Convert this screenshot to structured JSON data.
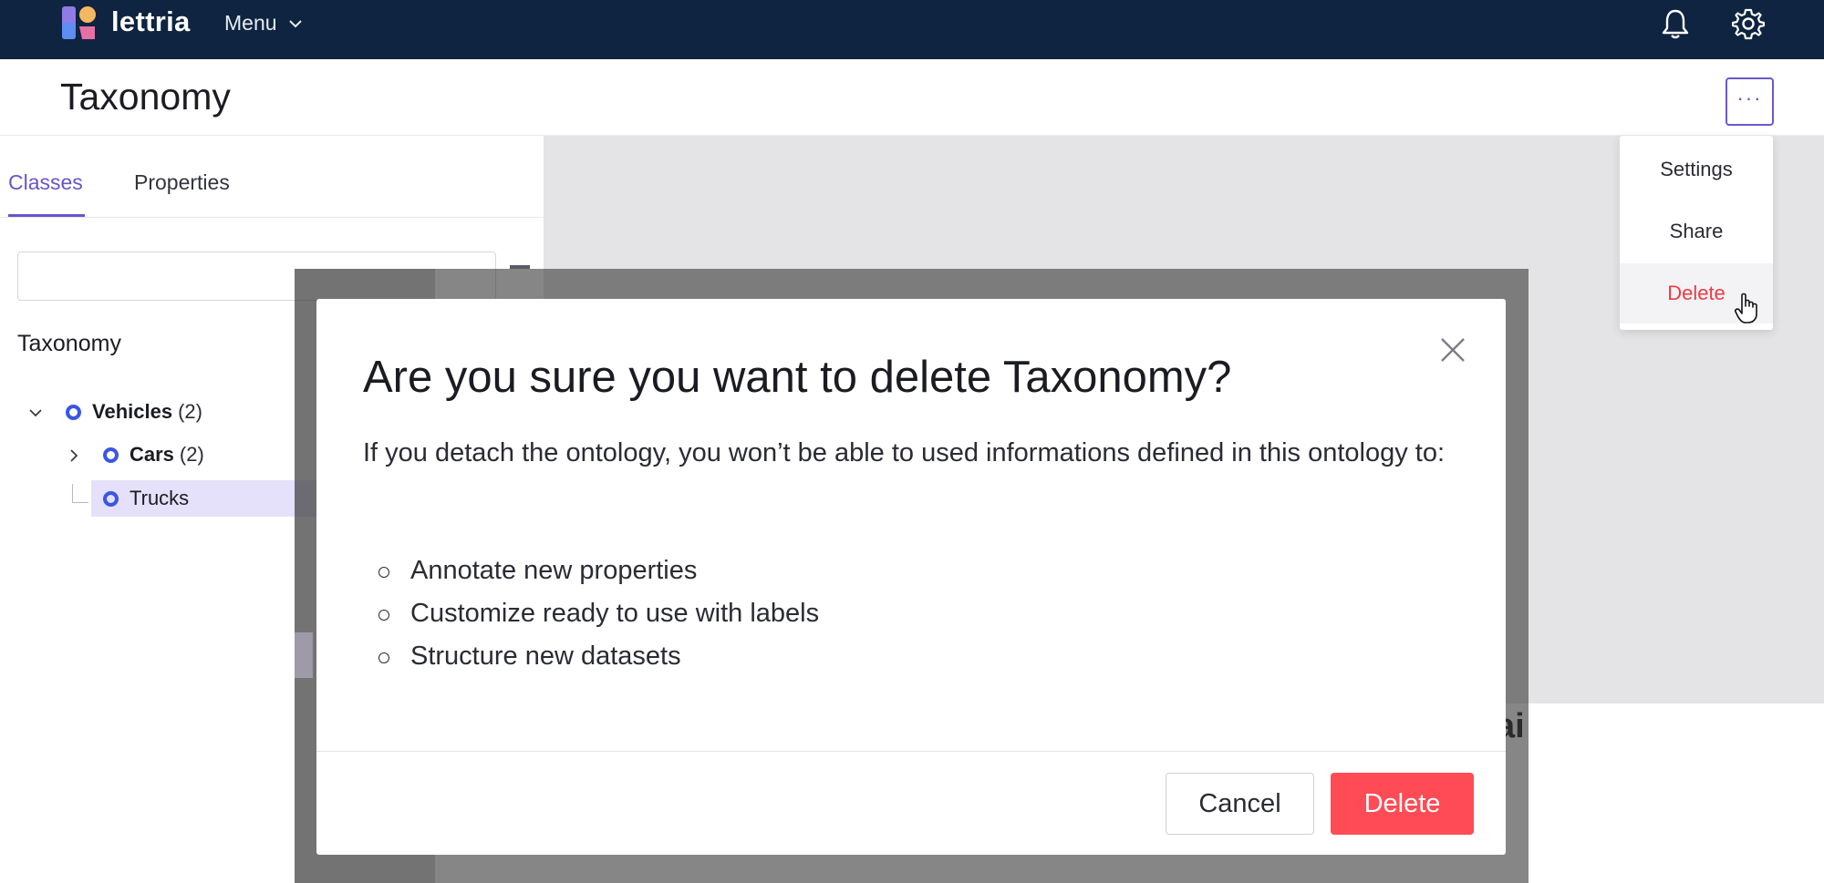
{
  "topnav": {
    "brand": "lettria",
    "menu_label": "Menu",
    "icons": [
      "logo-icon",
      "chevron-down-icon",
      "bell-icon",
      "gear-icon"
    ]
  },
  "header": {
    "title": "Taxonomy",
    "more_label": "···"
  },
  "left_panel": {
    "tabs": [
      {
        "label": "Classes",
        "active": true
      },
      {
        "label": "Properties",
        "active": false
      }
    ],
    "search_value": "",
    "tree_title": "Taxonomy",
    "tree": [
      {
        "label": "Vehicles",
        "count": "(2)",
        "expanded": true
      },
      {
        "label": "Cars",
        "count": "(2)",
        "expanded": false
      },
      {
        "label": "Trucks",
        "count": "",
        "selected": true
      }
    ]
  },
  "dropdown": {
    "items": [
      {
        "label": "Settings"
      },
      {
        "label": "Share"
      },
      {
        "label": "Delete",
        "danger": true
      }
    ]
  },
  "modal": {
    "title": "Are you sure you want to delete Taxonomy?",
    "body": "If you detach the ontology, you won’t be able to used informations defined in this ontology to:",
    "bullets": [
      "Annotate new properties",
      "Customize ready to use with labels",
      "Structure new datasets"
    ],
    "cancel_label": "Cancel",
    "delete_label": "Delete"
  },
  "background_peek_text": "ai",
  "colors": {
    "nav_bg": "#0e2440",
    "accent": "#6a55c9",
    "node": "#3b55e6",
    "danger": "#ff4b55",
    "selected_bg": "#e6e1fa"
  }
}
